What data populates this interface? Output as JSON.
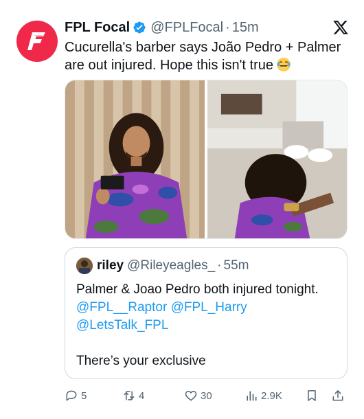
{
  "author": {
    "name": "FPL Focal",
    "handle": "@FPLFocal",
    "separator": "·",
    "time": "15m",
    "avatar_icon": "fpl-focal-logo",
    "verified_icon": "verified-badge-icon"
  },
  "tweet": {
    "text": "Cucurella's barber says João Pedro + Palmer are out injured. Hope this isn't true",
    "emoji": "laughing-tears-emoji"
  },
  "media": {
    "count": 2
  },
  "quote": {
    "name": "riley",
    "handle": "@Rileyeagles_",
    "separator": "·",
    "time": "55m",
    "line1": "Palmer & Joao Pedro both injured tonight.",
    "mention1": "@FPL__Raptor",
    "mention2": "@FPL_Harry",
    "mention3": "@LetsTalk_FPL",
    "line_last": "There’s your exclusive"
  },
  "actions": {
    "replies": "5",
    "reposts": "4",
    "likes": "30",
    "views": "2.9K"
  },
  "colors": {
    "brand": "#f0284a",
    "link": "#1d9bf0",
    "muted": "#536471"
  }
}
